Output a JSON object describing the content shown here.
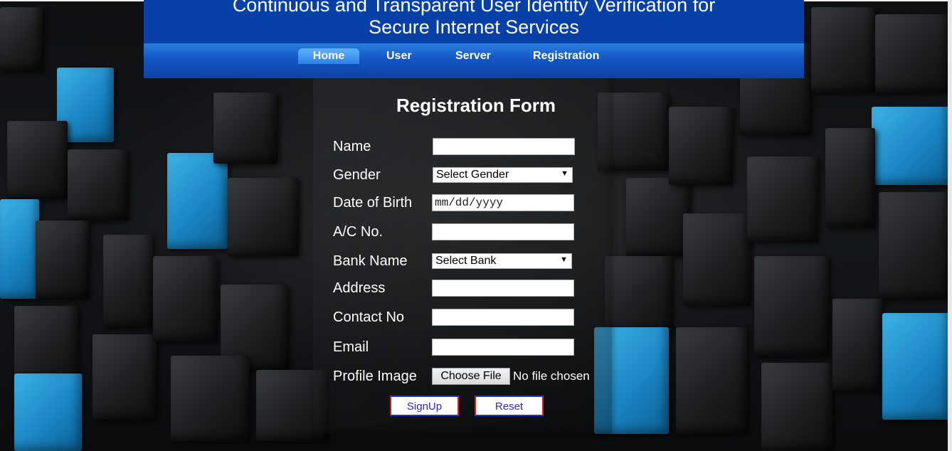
{
  "header": {
    "title_line1": "Continuous and Transparent User Identity Verification for",
    "title_line2": "Secure Internet Services"
  },
  "nav": {
    "items": [
      {
        "label": "Home",
        "active": true
      },
      {
        "label": "User",
        "active": false
      },
      {
        "label": "Server",
        "active": false
      },
      {
        "label": "Registration",
        "active": false
      }
    ]
  },
  "form": {
    "title": "Registration Form",
    "name_label": "Name",
    "name_value": "",
    "gender_label": "Gender",
    "gender_selected": "Select Gender",
    "dob_label": "Date of Birth",
    "dob_placeholder": "mm/dd/yyyy",
    "ac_label": "A/C No.",
    "ac_value": "",
    "bank_label": "Bank Name",
    "bank_selected": "Select Bank",
    "address_label": "Address",
    "address_value": "",
    "contact_label": "Contact No",
    "contact_value": "",
    "email_label": "Email",
    "email_value": "",
    "profile_label": "Profile Image",
    "file_button": "Choose File",
    "file_status": "No file chosen",
    "signup_label": "SignUp",
    "reset_label": "Reset"
  },
  "colors": {
    "header_bg": "#0741a8",
    "nav_active": "#2a84e6",
    "accent_blue_cube": "#1a86c4"
  }
}
